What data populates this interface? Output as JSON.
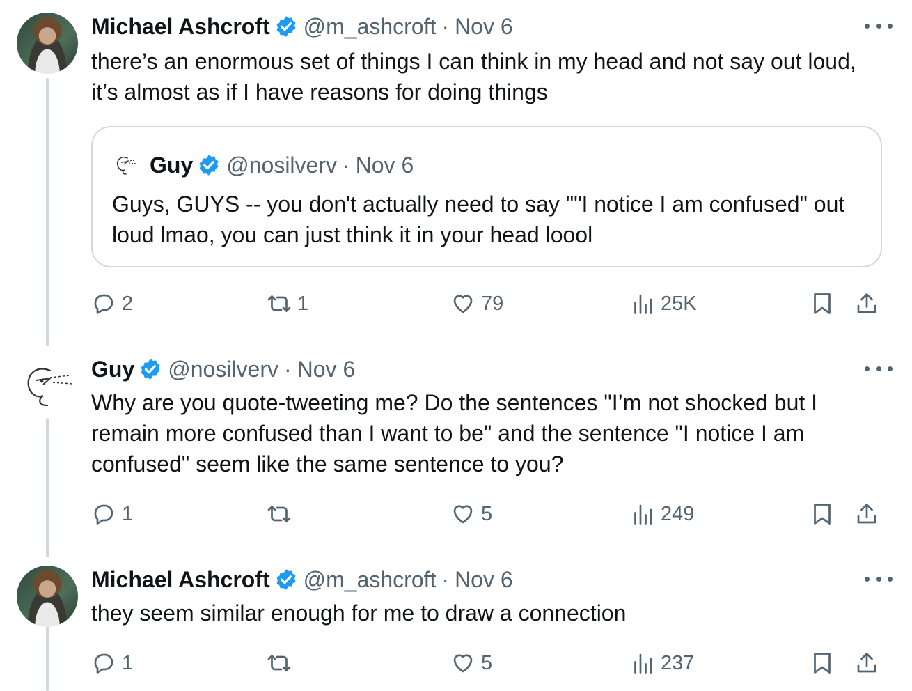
{
  "tweets": [
    {
      "author": "Michael Ashcroft",
      "handle": "@m_ashcroft",
      "sep": "·",
      "date": "Nov 6",
      "text": "there’s an enormous set of things I can think in my head and not say out loud, it’s almost as if I have reasons for doing things",
      "quote": {
        "author": "Guy",
        "handle": "@nosilverv",
        "sep": "·",
        "date": "Nov 6",
        "text": "Guys, GUYS -- you don't actually need to say \"\"I notice I am confused\" out loud lmao, you can just think it in your head loool"
      },
      "stats": {
        "replies": "2",
        "retweets": "1",
        "likes": "79",
        "views": "25K"
      }
    },
    {
      "author": "Guy",
      "handle": "@nosilverv",
      "sep": "·",
      "date": "Nov 6",
      "text": "Why are you quote-tweeting me? Do the sentences \"I’m not shocked but I remain more confused than I want to be\" and the sentence \"I notice I am confused\" seem like the same sentence to you?",
      "stats": {
        "replies": "1",
        "retweets": "",
        "likes": "5",
        "views": "249"
      }
    },
    {
      "author": "Michael Ashcroft",
      "handle": "@m_ashcroft",
      "sep": "·",
      "date": "Nov 6",
      "text": "they seem similar enough for me to draw a connection",
      "stats": {
        "replies": "1",
        "retweets": "",
        "likes": "5",
        "views": "237"
      }
    }
  ],
  "colors": {
    "verified": "#1d9bf0",
    "muted": "#536471",
    "thread_line": "#cfd9de",
    "text": "#0f1419"
  },
  "icons": [
    "reply-icon",
    "retweet-icon",
    "like-icon",
    "views-icon",
    "bookmark-icon",
    "share-icon",
    "verified-badge-icon",
    "more-icon"
  ]
}
